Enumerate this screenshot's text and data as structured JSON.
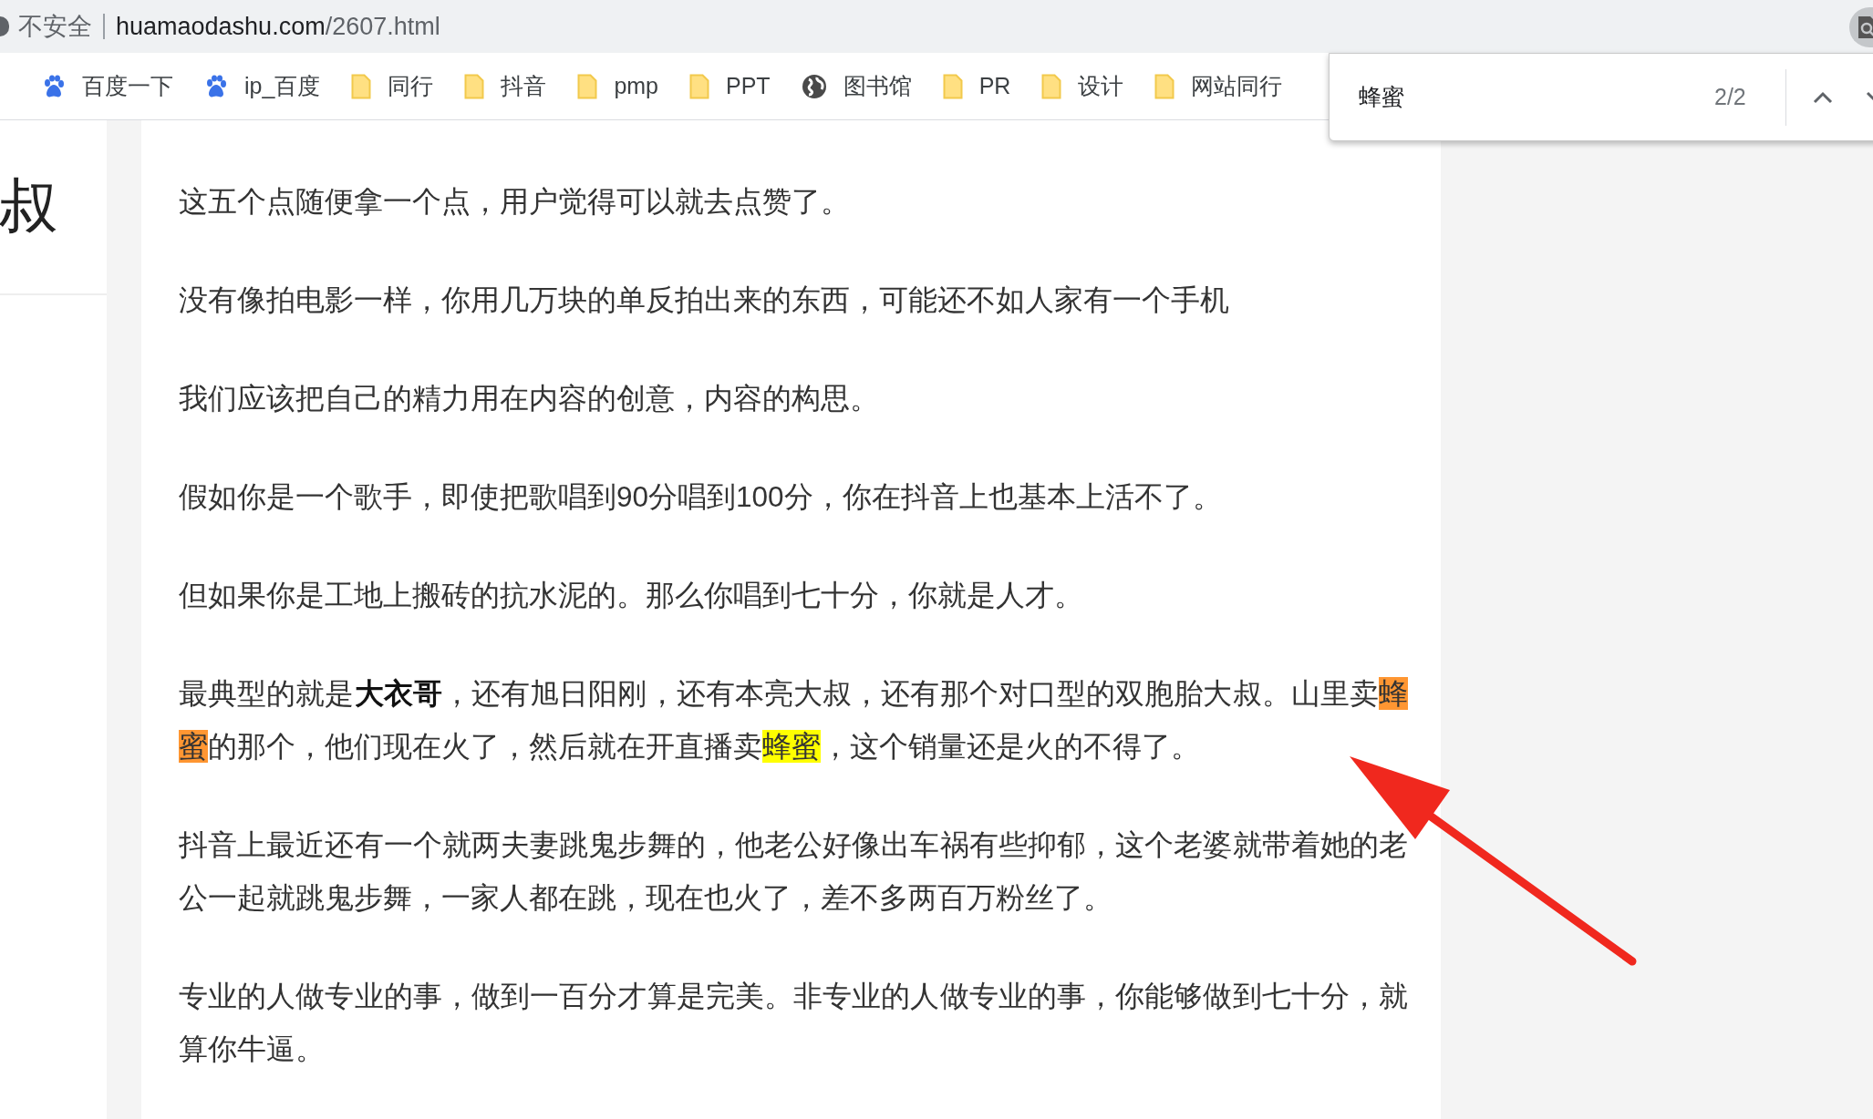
{
  "address_bar": {
    "security": "不安全",
    "domain": "huamaodashu.com",
    "path": "/2607.html"
  },
  "bookmarks": [
    {
      "kind": "paw",
      "label": "百度一下"
    },
    {
      "kind": "paw",
      "label": "ip_百度"
    },
    {
      "kind": "folder",
      "label": "同行"
    },
    {
      "kind": "folder",
      "label": "抖音"
    },
    {
      "kind": "folder",
      "label": "pmp"
    },
    {
      "kind": "folder",
      "label": "PPT"
    },
    {
      "kind": "globe",
      "label": "图书馆"
    },
    {
      "kind": "folder",
      "label": "PR"
    },
    {
      "kind": "folder",
      "label": "设计"
    },
    {
      "kind": "folder",
      "label": "网站同行"
    }
  ],
  "find_bar": {
    "value": "蜂蜜",
    "count": "2/2"
  },
  "sidebar": {
    "heading": "叔"
  },
  "article": {
    "paragraphs": [
      [
        {
          "kind": "plain",
          "text": "这五个点随便拿一个点，用户觉得可以就去点赞了。"
        }
      ],
      [
        {
          "kind": "plain",
          "text": "没有像拍电影一样，你用几万块的单反拍出来的东西，可能还不如人家有一个手机"
        }
      ],
      [
        {
          "kind": "plain",
          "text": "我们应该把自己的精力用在内容的创意，内容的构思。"
        }
      ],
      [
        {
          "kind": "plain",
          "text": "假如你是一个歌手，即使把歌唱到90分唱到100分，你在抖音上也基本上活不了。"
        }
      ],
      [
        {
          "kind": "plain",
          "text": "但如果你是工地上搬砖的抗水泥的。那么你唱到七十分，你就是人才。"
        }
      ],
      [
        {
          "kind": "plain",
          "text": "最典型的就是"
        },
        {
          "kind": "bold",
          "text": "大衣哥"
        },
        {
          "kind": "plain",
          "text": "，还有旭日阳刚，还有本亮大叔，还有那个对口型的双胞胎大叔。山里卖"
        },
        {
          "kind": "match",
          "text": "蜂蜜",
          "selected": true
        },
        {
          "kind": "plain",
          "text": "的那个，他们现在火了，然后就在开直播卖"
        },
        {
          "kind": "match",
          "text": "蜂蜜",
          "selected": false
        },
        {
          "kind": "plain",
          "text": "，这个销量还是火的不得了。"
        }
      ],
      [
        {
          "kind": "plain",
          "text": "抖音上最近还有一个就两夫妻跳鬼步舞的，他老公好像出车祸有些抑郁，这个老婆就带着她的老公一起就跳鬼步舞，一家人都在跳，现在也火了，差不多两百万粉丝了。"
        }
      ],
      [
        {
          "kind": "plain",
          "text": "专业的人做专业的事，做到一百分才算是完美。非专业的人做专业的事，你能够做到七十分，就算你牛逼。"
        }
      ]
    ]
  }
}
